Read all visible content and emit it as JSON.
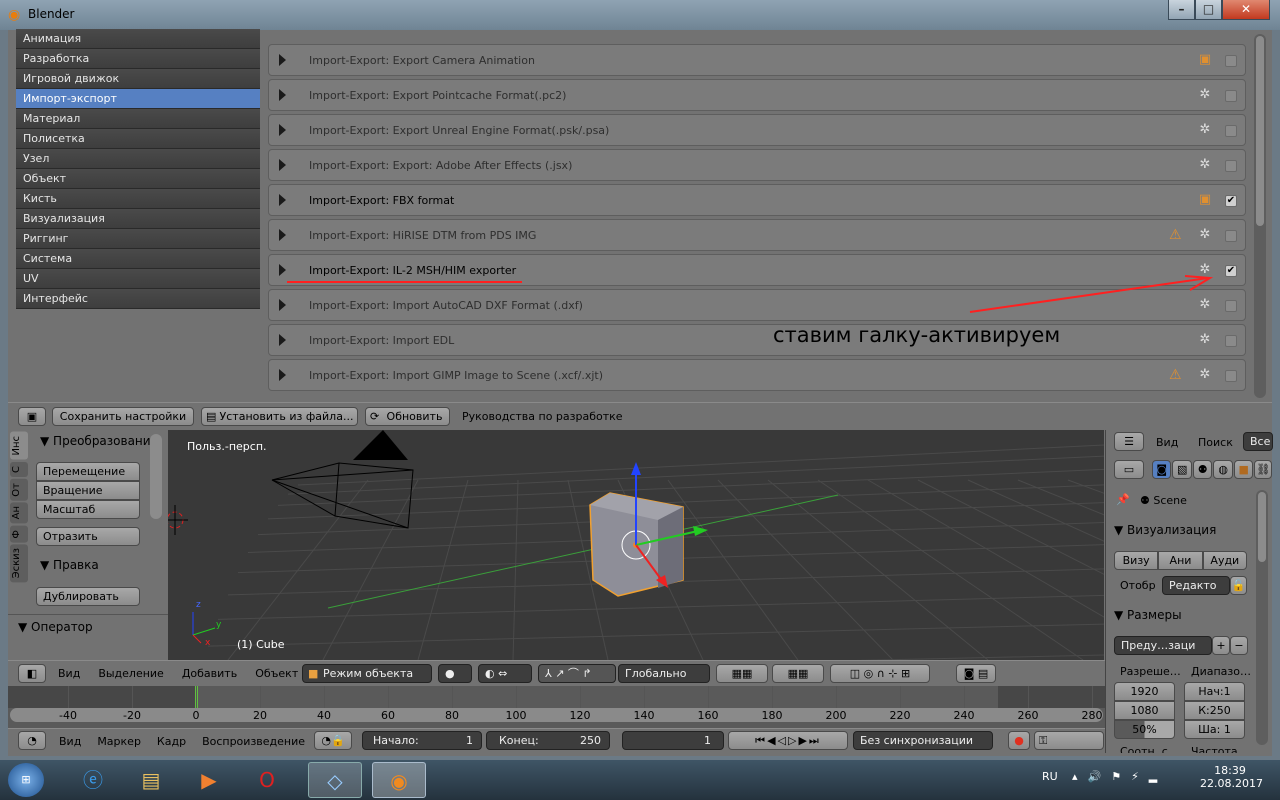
{
  "window": {
    "title": "Blender",
    "minimize": "–",
    "maximize": "□",
    "close": "✕"
  },
  "categories": [
    "Анимация",
    "Разработка",
    "Игровой движок",
    "Импорт-экспорт",
    "Материал",
    "Полисетка",
    "Узел",
    "Объект",
    "Кисть",
    "Визуализация",
    "Риггинг",
    "Система",
    "UV",
    "Интерфейс"
  ],
  "selected_category": "Импорт-экспорт",
  "addons": [
    {
      "name": "Import-Export: Export Camera Animation",
      "enabled": false,
      "icon": "addon-icon",
      "warning": false
    },
    {
      "name": "Import-Export: Export Pointcache Format(.pc2)",
      "enabled": false,
      "icon": "community-icon",
      "warning": false
    },
    {
      "name": "Import-Export: Export Unreal Engine Format(.psk/.psa)",
      "enabled": false,
      "icon": "community-icon",
      "warning": false
    },
    {
      "name": "Import-Export: Export: Adobe After Effects (.jsx)",
      "enabled": false,
      "icon": "community-icon",
      "warning": false
    },
    {
      "name": "Import-Export: FBX format",
      "enabled": true,
      "icon": "addon-icon",
      "warning": false
    },
    {
      "name": "Import-Export: HiRISE DTM from PDS IMG",
      "enabled": false,
      "icon": "community-icon",
      "warning": true
    },
    {
      "name": "Import-Export: IL-2 MSH/HIM exporter",
      "enabled": true,
      "icon": "community-icon",
      "warning": false
    },
    {
      "name": "Import-Export: Import AutoCAD DXF Format (.dxf)",
      "enabled": false,
      "icon": "community-icon",
      "warning": false
    },
    {
      "name": "Import-Export: Import EDL",
      "enabled": false,
      "icon": "community-icon",
      "warning": false
    },
    {
      "name": "Import-Export: Import GIMP Image to Scene (.xcf/.xjt)",
      "enabled": false,
      "icon": "community-icon",
      "warning": true
    }
  ],
  "annotation": {
    "text": "ставим галку-активируем",
    "color": "#ff2020"
  },
  "prefs_header": {
    "save": "Сохранить настройки",
    "install": "Установить из файла...",
    "refresh": "Обновить",
    "guides": "Руководства по разработке"
  },
  "toolshelf": {
    "tabs": [
      "Инс",
      "С",
      "От",
      "Ан",
      "Ф",
      "Эскиз"
    ],
    "transform_title": "Преобразовани",
    "transform_buttons": [
      "Перемещение",
      "Вращение",
      "Масштаб"
    ],
    "mirror": "Отразить",
    "edit_title": "Правка",
    "duplicate": "Дублировать",
    "operator": "Оператор"
  },
  "viewport": {
    "view_name": "Польз.-персп.",
    "object_label": "(1) Cube",
    "axes": [
      "z",
      "y",
      "x"
    ]
  },
  "view3d_header": {
    "menus": [
      "Вид",
      "Выделение",
      "Добавить",
      "Объект"
    ],
    "mode": "Режим объекта",
    "orientation": "Глобально"
  },
  "timeline": {
    "ticks": [
      "-40",
      "-20",
      "0",
      "20",
      "40",
      "60",
      "80",
      "100",
      "120",
      "140",
      "160",
      "180",
      "200",
      "220",
      "240",
      "260",
      "280"
    ],
    "current_frame": 1,
    "menus": [
      "Вид",
      "Маркер",
      "Кадр",
      "Воспроизведение"
    ],
    "start_label": "Начало:",
    "start": "1",
    "end_label": "Конец:",
    "end": "250",
    "frame": "1",
    "sync": "Без синхронизации"
  },
  "outliner_header": {
    "view": "Вид",
    "search": "Поиск",
    "all": "Все"
  },
  "properties": {
    "scene": "Scene",
    "render_title": "Визуализация",
    "render_buttons": [
      "Визу",
      "Ани",
      "Ауди"
    ],
    "display_label": "Отобр",
    "display_value": "Редакто",
    "dimensions_title": "Размеры",
    "preset": "Преду…заци",
    "resolution_label": "Разреше…",
    "range_label": "Диапазо…",
    "res_x": "1920",
    "res_y": "1080",
    "res_pct": "50%",
    "res_pct_value": 50,
    "frame_start": "Нач:1",
    "frame_end": "К:250",
    "frame_step": "Ша: 1",
    "aspect_label": "Соотн. с…",
    "fps_label": "Частота…"
  },
  "taskbar": {
    "lang": "RU",
    "time": "18:39",
    "date": "22.08.2017"
  }
}
